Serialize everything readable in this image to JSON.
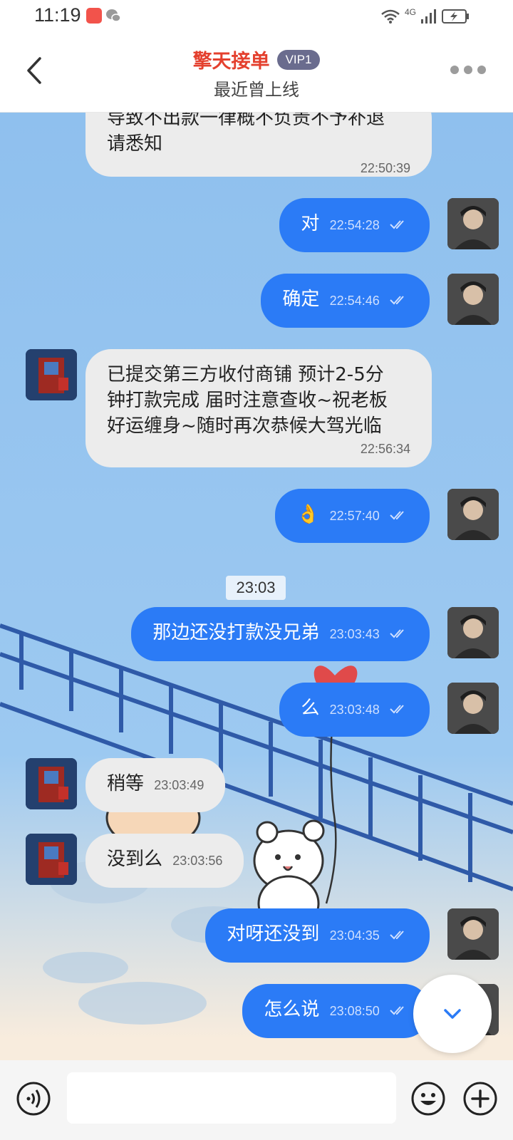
{
  "status_bar": {
    "time": "11:19",
    "network": "4G"
  },
  "header": {
    "title": "擎天接单",
    "vip": "VIP1",
    "subtitle": "最近曾上线"
  },
  "messages": [
    {
      "side": "them",
      "text": "导致不出款一律概不负责不予补退\n请悉知",
      "time": "22:50:39"
    },
    {
      "side": "me",
      "text": "对",
      "time": "22:54:28"
    },
    {
      "side": "me",
      "text": "确定",
      "time": "22:54:46"
    },
    {
      "side": "them",
      "text": "已提交第三方收付商铺 预计2-5分\n钟打款完成 届时注意查收~祝老板\n好运缠身~随时再次恭候大驾光临",
      "time": "22:56:34"
    },
    {
      "side": "me",
      "text": "👌",
      "time": "22:57:40"
    },
    {
      "side": "me",
      "text": "那边还没打款没兄弟",
      "time": "23:03:43"
    },
    {
      "side": "me",
      "text": "么",
      "time": "23:03:48"
    },
    {
      "side": "them",
      "text": "稍等",
      "time": "23:03:49"
    },
    {
      "side": "them",
      "text": "没到么",
      "time": "23:03:56"
    },
    {
      "side": "me",
      "text": "对呀还没到",
      "time": "23:04:35"
    },
    {
      "side": "me",
      "text": "怎么说",
      "time": "23:08:50"
    }
  ],
  "time_separator": "23:03",
  "input": {
    "placeholder": ""
  },
  "colors": {
    "title": "#e4402e",
    "my_bubble": "#2b7bf6",
    "their_bubble": "#ececec",
    "vip_badge": "#6a6c8e"
  },
  "icons": {
    "back": "chevron-left-icon",
    "more": "more-dots-icon",
    "voice": "voice-icon",
    "emoji": "emoji-icon",
    "plus": "plus-icon",
    "scroll_down": "chevron-down-icon",
    "read": "double-check-icon"
  }
}
